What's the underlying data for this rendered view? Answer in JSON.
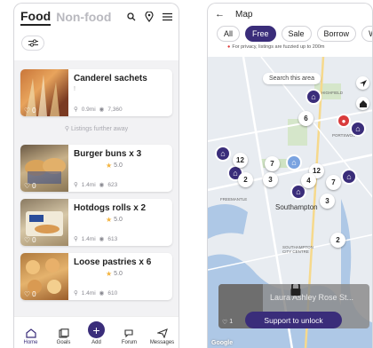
{
  "left_phone": {
    "tabs": {
      "food": "Food",
      "non_food": "Non-food"
    },
    "listings": [
      {
        "title": "Canderel sachets",
        "subtitle": "!",
        "distance": "0.9mi",
        "views": "7,360",
        "likes": "0"
      },
      {
        "title": "Burger buns x 3",
        "rating": "5.0",
        "distance": "1.4mi",
        "views": "623",
        "likes": "0"
      },
      {
        "title": "Hotdogs rolls x 2",
        "rating": "5.0",
        "distance": "1.4mi",
        "views": "613",
        "likes": "0"
      },
      {
        "title": "Loose pastries x 6",
        "rating": "5.0",
        "distance": "1.4mi",
        "views": "610",
        "likes": "0"
      }
    ],
    "separator_text": "Listings further away",
    "nav": [
      "Home",
      "Goals",
      "Add",
      "Forum",
      "Messages"
    ]
  },
  "right_phone": {
    "title": "Map",
    "chips": [
      "All",
      "Free",
      "Sale",
      "Borrow",
      "Wa"
    ],
    "privacy_note": "For privacy, listings are fuzzied up to 200m",
    "search_area": "Search this area",
    "clusters": [
      "6",
      "12",
      "7",
      "3",
      "12",
      "4",
      "7",
      "2",
      "3",
      "2"
    ],
    "labels": {
      "city": "Southampton",
      "centre": "SOUTHAMPTON\nCITY CENTRE",
      "freemantle": "FREEMANTLE",
      "portswood": "PORTSWOOD",
      "highfield": "HIGHFIELD"
    },
    "card_title": "Laura Ashley Rose St...",
    "card_likes": "1",
    "unlock_button": "Support to unlock",
    "google_logo": "Google"
  }
}
